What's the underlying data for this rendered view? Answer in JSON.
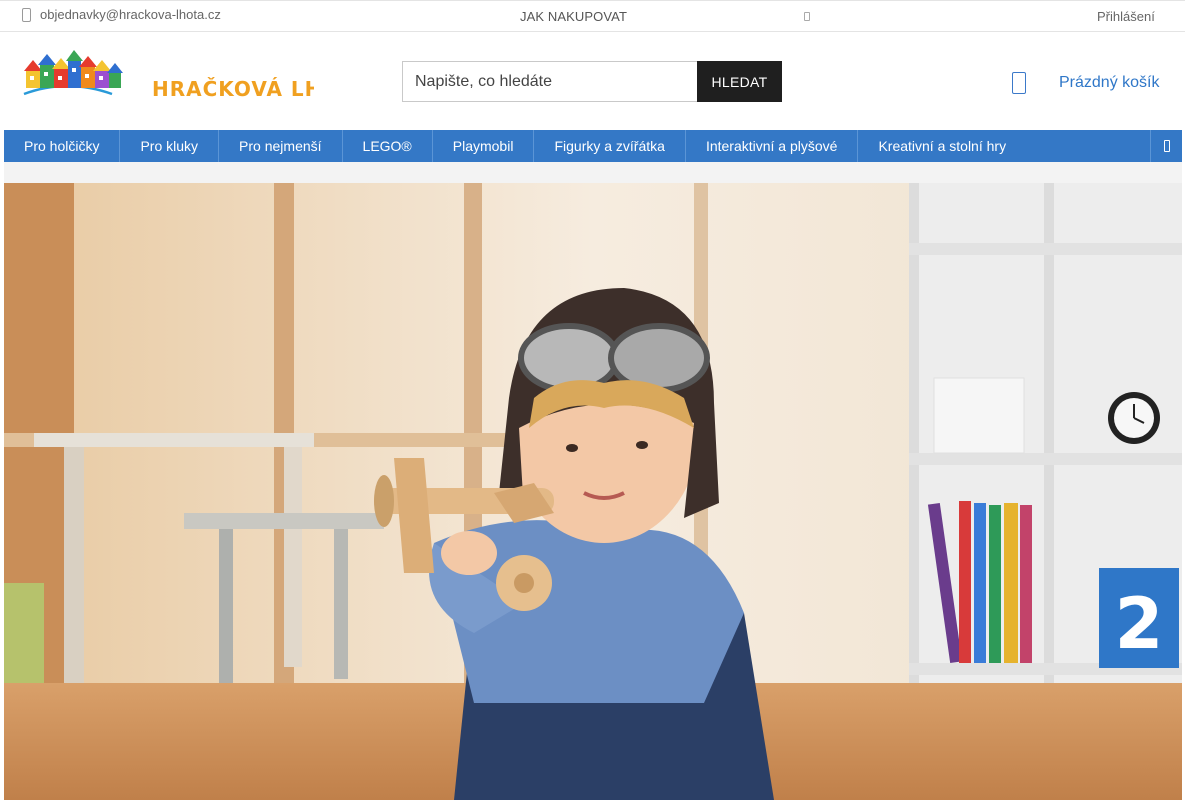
{
  "topbar": {
    "email": "objednavky@hrackova-lhota.cz",
    "how_to_shop": "JAK NAKUPOVAT",
    "login": "Přihlášení"
  },
  "header": {
    "logo_text": "HRAČKOVÁ LHOTA",
    "search": {
      "placeholder": "Napište, co hledáte",
      "button_label": "HLEDAT"
    },
    "cart_label": "Prázdný košík"
  },
  "nav": {
    "items": [
      "Pro holčičky",
      "Pro kluky",
      "Pro nejmenší",
      "LEGO®",
      "Playmobil",
      "Figurky a zvířátka",
      "Interaktivní a plyšové",
      "Kreativní a stolní hry"
    ]
  },
  "hero": {
    "image_subject": "boy-pilot-wooden-airplane",
    "shelf_number": "2"
  },
  "colors": {
    "accent": "#3478c6",
    "search_button": "#1f1f1f",
    "logo_text": "#f0a020"
  }
}
